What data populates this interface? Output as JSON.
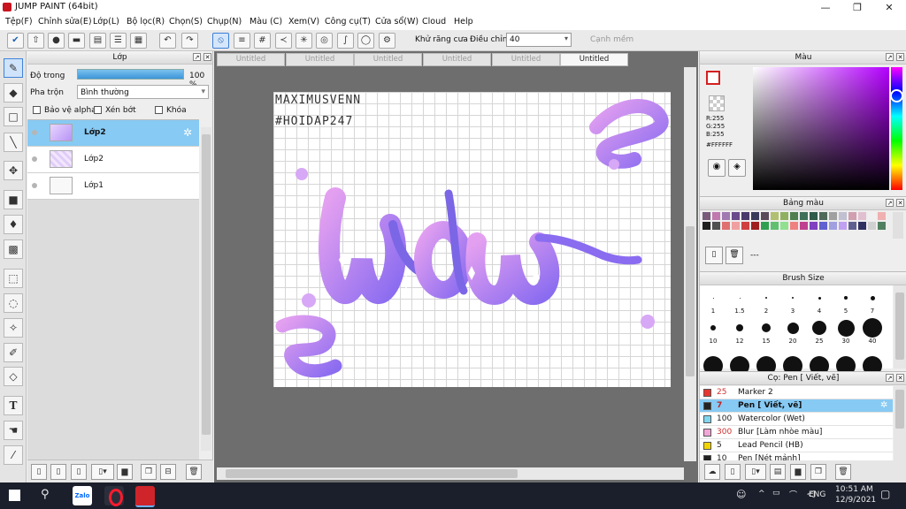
{
  "window": {
    "title": "JUMP PAINT (64bit)"
  },
  "menu": [
    "Tệp(F)",
    "Chỉnh sửa(E)",
    "Lớp(L)",
    "Bộ lọc(R)",
    "Chọn(S)",
    "Chụp(N)",
    "Màu (C)",
    "Xem(V)",
    "Công cụ(T)",
    "Cửa sổ(W)",
    "Cloud",
    "Help"
  ],
  "toolbar": {
    "antialias_label": "Khử răng cưa",
    "adjust_label": "Điều chỉnh",
    "adjust_value": "40",
    "snap_label": "Cạnh mềm"
  },
  "layer_panel": {
    "title": "Lớp",
    "opacity_label": "Độ trong",
    "opacity_value": "100 %",
    "opacity_fraction": 1.0,
    "blend_label": "Pha trộn",
    "blend_value": "Bình thường",
    "protect_alpha_label": "Bảo vệ alpha",
    "clip_label": "Xén bớt",
    "lock_label": "Khóa",
    "layers": [
      {
        "name": "Lớp2",
        "selected": true
      },
      {
        "name": "Lớp2",
        "selected": false
      },
      {
        "name": "Lớp1",
        "selected": false
      }
    ]
  },
  "tabs": [
    "Untitled",
    "Untitled",
    "Untitled",
    "Untitled",
    "Untitled",
    "Untitled"
  ],
  "canvas_text": {
    "line1": "MAXIMUSVENN",
    "line2": "#HOIDAP247"
  },
  "color_panel": {
    "title": "Màu",
    "r": "R:255",
    "g": "G:255",
    "b": "B:255",
    "hex": "#FFFFFF"
  },
  "swatch_panel": {
    "title": "Bảng màu",
    "more": "---"
  },
  "brush_size": {
    "title": "Brush Size",
    "row1": [
      "1",
      "1.5",
      "2",
      "3",
      "4",
      "5",
      "7"
    ],
    "row2": [
      "10",
      "12",
      "15",
      "20",
      "25",
      "30",
      "40"
    ]
  },
  "pen_panel": {
    "title": "Cọ: Pen [ Viết, vẽ]",
    "items": [
      {
        "size": "25",
        "name": "Marker 2",
        "color": "#e8352f",
        "selected": false
      },
      {
        "size": "7",
        "name": "Pen [ Viết, vẽ]",
        "color": "#222222",
        "selected": true
      },
      {
        "size": "100",
        "name": "Watercolor (Wet)",
        "color": "#7fd6f0",
        "selected": false
      },
      {
        "size": "300",
        "name": "Blur [Làm nhòe màu]",
        "color": "#f2a6d6",
        "selected": false
      },
      {
        "size": "5",
        "name": "Lead Pencil (HB)",
        "color": "#f2d400",
        "selected": false
      },
      {
        "size": "10",
        "name": "Pen [Nét mảnh]",
        "color": "#222222",
        "selected": false
      }
    ]
  },
  "taskbar": {
    "lang": "ENG",
    "time": "10:51 AM",
    "date": "12/9/2021"
  },
  "colors": {
    "accent": "#87caf3",
    "canvas_bg": "#6e6e6e"
  }
}
